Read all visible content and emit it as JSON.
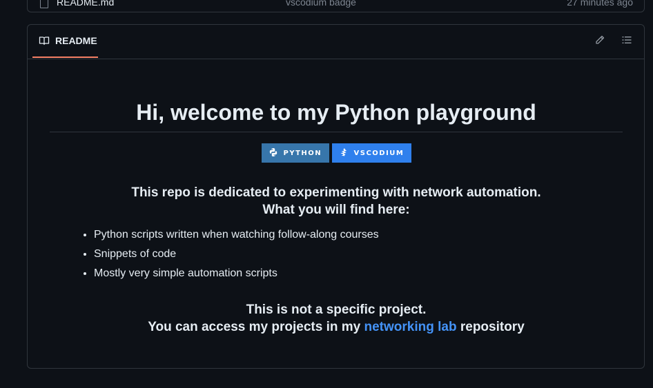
{
  "file_row": {
    "name": "README.md",
    "commit_message": "vscodium badge",
    "time": "27 minutes ago"
  },
  "readme": {
    "tab_label": "README",
    "icons": {
      "tab": "book-icon",
      "edit": "pencil-icon",
      "outline": "list-icon"
    },
    "accent_color": "#f78166",
    "title": "Hi, welcome to my Python playground",
    "badges": [
      {
        "label": "PYTHON",
        "icon": "python-icon",
        "color": "#3776ab"
      },
      {
        "label": "VSCODIUM",
        "icon": "vscodium-icon",
        "color": "#2f80ed"
      }
    ],
    "intro_line1": "This repo is dedicated to experimenting with network automation.",
    "intro_line2": "What you will find here:",
    "features": [
      "Python scripts written when watching follow-along courses",
      "Snippets of code",
      "Mostly very simple automation scripts"
    ],
    "outro_line1": "This is not a specific project.",
    "outro_line2_before": "You can access my projects in my ",
    "outro_link": "networking lab",
    "outro_line2_after": " repository",
    "link_color": "#4493f8"
  }
}
